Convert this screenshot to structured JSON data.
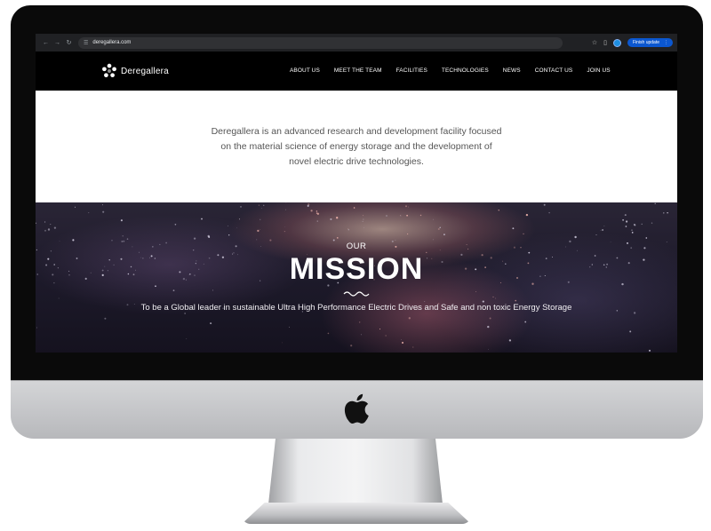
{
  "browser": {
    "url": "deregallera.com",
    "update_button_label": "Finish update",
    "nav_icons": [
      "back-arrow-icon",
      "forward-arrow-icon",
      "reload-icon",
      "site-settings-icon",
      "bookmark-star-icon",
      "extensions-icon",
      "profile-icon",
      "more-menu-icon"
    ]
  },
  "site": {
    "logo_text": "Deregallera",
    "nav_items": [
      "ABOUT US",
      "MEET THE TEAM",
      "FACILITIES",
      "TECHNOLOGIES",
      "NEWS",
      "CONTACT US",
      "JOIN US"
    ]
  },
  "intro": {
    "text": "Deregallera is an advanced research and development facility focused on the material science of energy storage and the development of novel electric drive technologies."
  },
  "hero": {
    "eyebrow": "OUR",
    "title": "MISSION",
    "subtitle": "To be a Global leader in sustainable Ultra High Performance Electric Drives and Safe and non toxic Energy Storage"
  },
  "colors": {
    "device_bezel": "#0a0a0a",
    "chin": "#c4c5c8",
    "site_header_bg": "#000000",
    "update_pill": "#0b57d0",
    "intro_text": "#555555"
  }
}
